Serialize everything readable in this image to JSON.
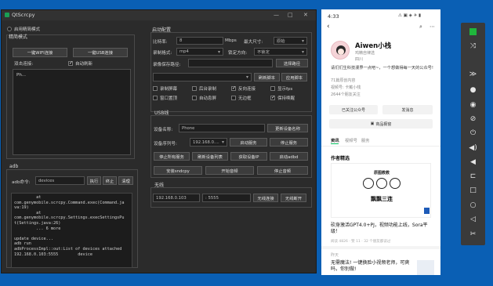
{
  "qt": {
    "title": "QtScrcpy",
    "win_min": "—",
    "win_max": "□",
    "win_close": "✕",
    "wireless": {
      "group_title": "无线",
      "ip": "192.168.0.103",
      "port": ": 5555",
      "connect": "无线连接",
      "disconnect": "无线断开"
    }
  },
  "left": {
    "use_simple_mode": "启用精简模式",
    "simple_mode_group": "精简模式",
    "btn_wifi": "一键WIFI连接",
    "btn_usb": "一键USB连接",
    "serial_label": "双击连接:",
    "auto_refresh": "自动刷新",
    "device_item": "Ph..."
  },
  "start_config": {
    "title": "启动配置",
    "bitrate_label": "比特率:",
    "bitrate_value": "8",
    "bitrate_unit": "Mbps",
    "max_size_label": "最大尺寸:",
    "max_size_value": "原始",
    "record_format_label": "录制格式:",
    "record_format_value": "mp4",
    "lock_orientation_label": "锁定方向:",
    "lock_orientation_value": "不锁定",
    "save_path_label": "录像保存路径:",
    "save_path_button": "选择路径",
    "refresh_script": "刷新脚本",
    "apply_script": "应用脚本",
    "checks": [
      {
        "label": "录制屏幕",
        "checked": false
      },
      {
        "label": "后台录制",
        "checked": false
      },
      {
        "label": "反向连接",
        "checked": true
      },
      {
        "label": "显示fps",
        "checked": false
      },
      {
        "label": "窗口置顶",
        "checked": false
      },
      {
        "label": "自动息屏",
        "checked": false
      },
      {
        "label": "无边框",
        "checked": false
      },
      {
        "label": "保持唤醒",
        "checked": true
      }
    ]
  },
  "usb": {
    "group_title": "USB线",
    "device_name_label": "设备名称:",
    "device_name_value": "Phone",
    "update_name": "更新设备名称",
    "serial_label": "设备序列号:",
    "serial_value": "192.168.0....",
    "start_service": "启动服务",
    "stop_service": "停止服务",
    "stop_all": "停止所有服务",
    "refresh_devices": "刷新设备列表",
    "get_ip": "获取设备IP",
    "start_adbd": "启动adbd",
    "install_sndcpy": "安装sndcpy",
    "start_audio": "开始音频",
    "stop_audio": "停止音频"
  },
  "adb": {
    "group_title": "adb",
    "cmd_label": "adb命令:",
    "cmd_value": "devices",
    "execute": "执行",
    "stop": "终止",
    "clear": "清理",
    "log": [
      "         at",
      "com.genymobile.scrcpy.Command.exec(Command.ja",
      "va:19)",
      "         at",
      "com.genymobile.scrcpy.Settings.execSettingsPu",
      "t(Settings.java:26)",
      "         ... 6 more",
      "",
      "update device...",
      "adb run",
      "adbProcessImpl::out:List of devices attached",
      "192.168.0.103:5555        device"
    ]
  },
  "phone": {
    "time": "4:33",
    "status_icons": "⚠ ▣ ◈ ✈ ▮",
    "name": "Aiwen小栈",
    "verified": "鸡精自律选",
    "badge": "四川",
    "desc": "请们们生科技漫界一点吧~，一个想做得每一天的公众号!",
    "stats": [
      "71篇原创内容",
      "视频号: 卡戴小栈",
      "2644个朋友关注"
    ],
    "btn_follow": "已关注公众号",
    "btn_message": "发消息",
    "btn_store": "商品橱窗",
    "tabs": [
      "资讯",
      "视频号",
      "服务"
    ],
    "section": "作者精选",
    "card_top": "原图教教",
    "card_mid": "飘飘三连",
    "article1_title": "砍身激活GPT4.0+PJ，视频功能上线，Sora平级！",
    "article1_meta": "阅读 4826 · 赞 11 · 32 个朋友都读过",
    "article2_date": "昨天",
    "article2_title": "无需魔法! 一键换脸小视频老师，可爽吗，你别做!"
  },
  "toolbar": {
    "icons": [
      "power-indicator-icon",
      "fullscreen-icon",
      "collapse-icon",
      "circle-icon",
      "eye-icon",
      "eye-off-icon",
      "power-icon",
      "volume-up-icon",
      "volume-down-icon",
      "rotate-icon",
      "square-icon",
      "circle-outline-icon",
      "back-icon",
      "screenshot-icon"
    ]
  },
  "colors": {
    "desktop": "#0a5fb4",
    "window_bg": "#2b2b2b",
    "toolbar_bg": "#3a3a3a",
    "toolbar_active": "#1fb63c"
  }
}
